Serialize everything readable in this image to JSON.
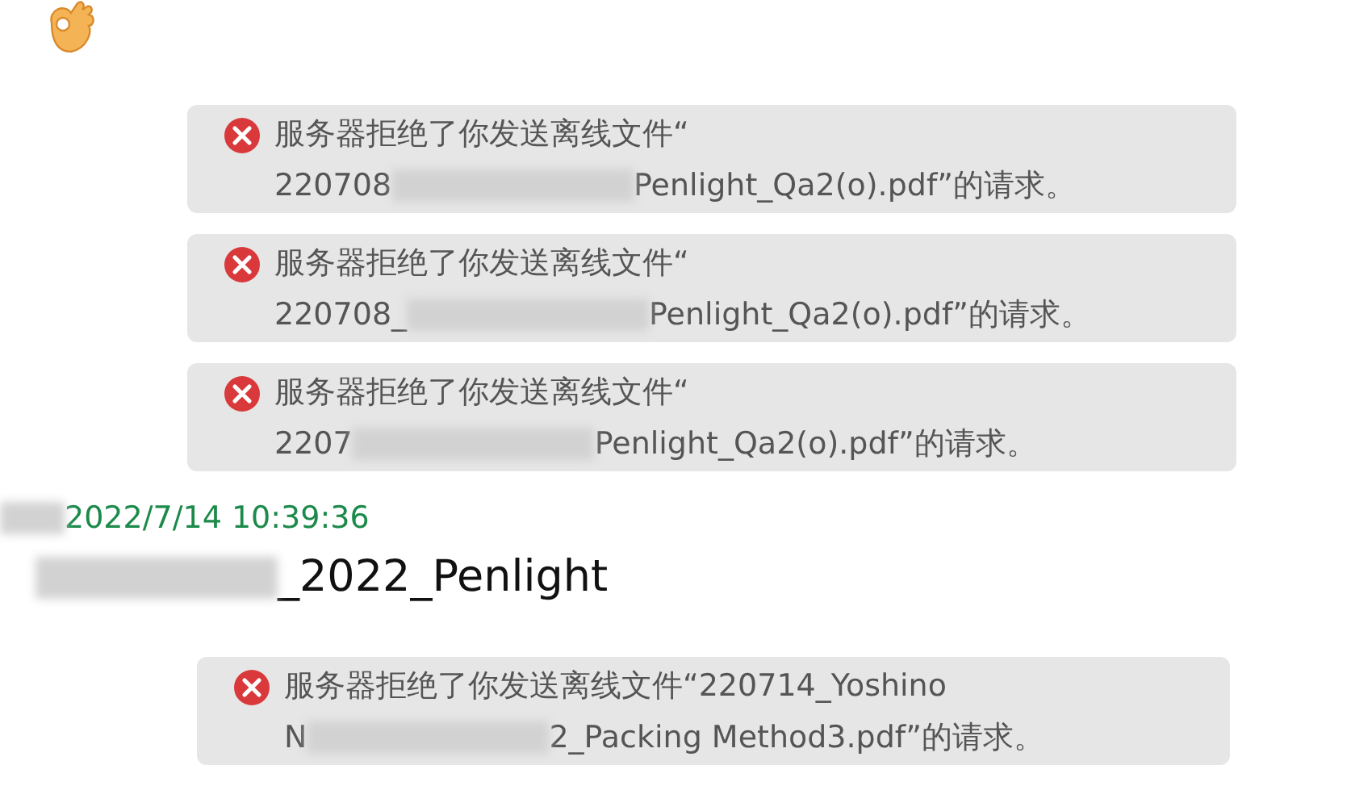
{
  "notices": [
    {
      "line1": "服务器拒绝了你发送离线文件“",
      "before": "220708",
      "after": "Penlight_Qa2(o).pdf”的请求。"
    },
    {
      "line1": "服务器拒绝了你发送离线文件“",
      "before": "220708_",
      "after": "Penlight_Qa2(o).pdf”的请求。"
    },
    {
      "line1": "服务器拒绝了你发送离线文件“",
      "before": "2207",
      "after": "Penlight_Qa2(o).pdf”的请求。"
    }
  ],
  "message": {
    "time": "2022/7/14 10:39:36",
    "text_after": "_2022_Penlight"
  },
  "last_notice": {
    "line1": "服务器拒绝了你发送离线文件“220714_Yoshino",
    "before": "N",
    "after": "2_Packing Method3.pdf”的请求。"
  }
}
